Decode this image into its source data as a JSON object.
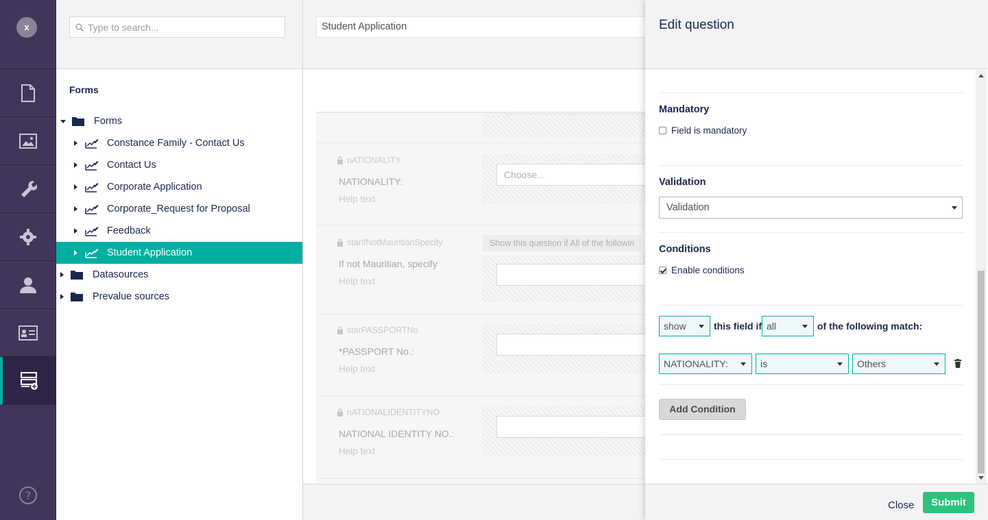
{
  "appbar": {
    "avatar_initial": "x",
    "sections": [
      "content-icon",
      "media-icon",
      "wrench-icon",
      "gear-icon",
      "user-icon",
      "member-card-icon",
      "forms-icon"
    ],
    "active_section": "forms-icon",
    "accent": "#00aea2"
  },
  "tree": {
    "search_placeholder": "Type to search...",
    "title": "Forms",
    "root_label": "Forms",
    "forms": [
      {
        "label": "Constance Family - Contact Us"
      },
      {
        "label": "Contact Us"
      },
      {
        "label": "Corporate Application"
      },
      {
        "label": "Corporate_Request for Proposal"
      },
      {
        "label": "Feedback"
      },
      {
        "label": "Student Application"
      }
    ],
    "selected_form": "Student Application",
    "other_roots": [
      {
        "label": "Datasources"
      },
      {
        "label": "Prevalue sources"
      }
    ]
  },
  "editor": {
    "form_name": "Student Application",
    "questions": [
      {
        "alias": "nATIONALITY",
        "label": "NATIONALITY:",
        "help": "Help text",
        "control": "select",
        "placeholder": "Choose..."
      },
      {
        "alias": "starIfNotMauritianSpecify",
        "label": "If not Mauritian, specify",
        "help": "Help text",
        "control": "input",
        "condition_note": "Show this question if All of the followin"
      },
      {
        "alias": "starPASSPORTNo",
        "label": "*PASSPORT No.:",
        "help": "Help text",
        "control": "input"
      },
      {
        "alias": "nATIONALIDENTITYNO",
        "label": "NATIONAL IDENTITY NO.:",
        "help": "Help text",
        "control": "input"
      }
    ]
  },
  "dialog": {
    "title": "Edit question",
    "mandatory": {
      "label": "Mandatory",
      "checkbox_label": "Field is mandatory",
      "checked": false
    },
    "validation": {
      "label": "Validation",
      "selected": "Validation"
    },
    "conditions": {
      "label": "Conditions",
      "checkbox_label": "Enable conditions",
      "checked": true,
      "action": "show",
      "text_middle": "this field if",
      "logic": "all",
      "text_end": "of the following match:",
      "rule": {
        "field": "NATIONALITY:",
        "operator": "is",
        "value": "Others"
      },
      "add_button": "Add Condition"
    },
    "close_label": "Close",
    "submit_label": "Submit",
    "submit_color": "#2bc37c"
  }
}
